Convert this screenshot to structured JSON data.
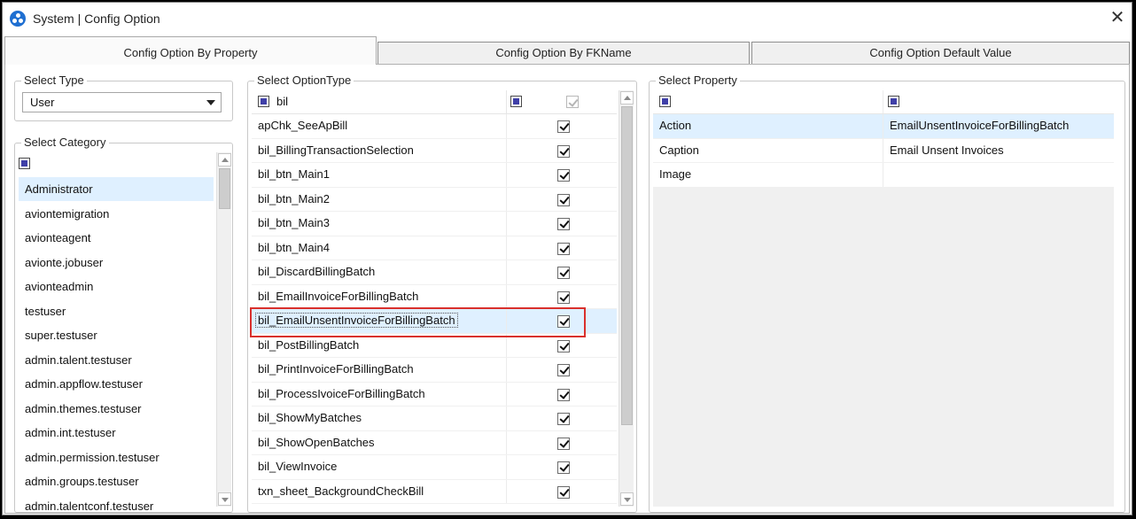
{
  "window": {
    "title": "System | Config Option",
    "close_glyph": "✕"
  },
  "tabs": [
    {
      "label": "Config Option By Property",
      "active": true
    },
    {
      "label": "Config Option By FKName",
      "active": false
    },
    {
      "label": "Config Option Default Value",
      "active": false
    }
  ],
  "select_type": {
    "label": "Select Type",
    "value": "User"
  },
  "select_category": {
    "label": "Select Category",
    "items": [
      "Administrator",
      "aviontemigration",
      "avionteagent",
      "avionte.jobuser",
      "avionteadmin",
      "testuser",
      "super.testuser",
      "admin.talent.testuser",
      "admin.appflow.testuser",
      "admin.themes.testuser",
      "admin.int.testuser",
      "admin.permission.testuser",
      "admin.groups.testuser",
      "admin.talentconf.testuser"
    ],
    "selected_index": 0
  },
  "select_option_type": {
    "label": "Select OptionType",
    "filter_text": "bil",
    "rows": [
      "apChk_SeeApBill",
      "bil_BillingTransactionSelection",
      "bil_btn_Main1",
      "bil_btn_Main2",
      "bil_btn_Main3",
      "bil_btn_Main4",
      "bil_DiscardBillingBatch",
      "bil_EmailInvoiceForBillingBatch",
      "bil_EmailUnsentInvoiceForBillingBatch",
      "bil_PostBillingBatch",
      "bil_PrintInvoiceForBillingBatch",
      "bil_ProcessIvoiceForBillingBatch",
      "bil_ShowMyBatches",
      "bil_ShowOpenBatches",
      "bil_ViewInvoice",
      "txn_sheet_BackgroundCheckBill"
    ],
    "all_checked": true,
    "selected_index": 8
  },
  "select_property": {
    "label": "Select Property",
    "rows": [
      {
        "key": "Action",
        "value": "EmailUnsentInvoiceForBillingBatch"
      },
      {
        "key": "Caption",
        "value": "Email Unsent Invoices"
      },
      {
        "key": "Image",
        "value": ""
      }
    ],
    "selected_index": 0
  },
  "colors": {
    "selection": "#dff0ff",
    "highlight_box": "#d9302c",
    "app_icon": "#1f6fd1"
  }
}
